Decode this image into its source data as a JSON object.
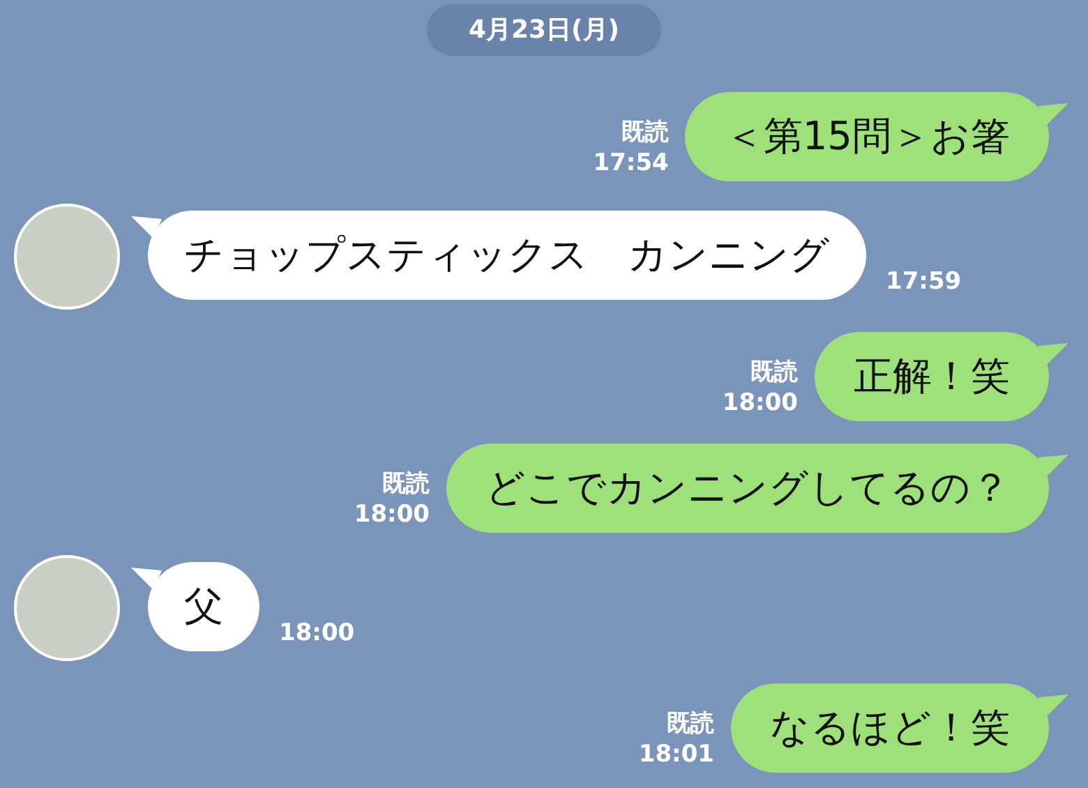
{
  "date_label": "4月23日(月)",
  "messages": [
    {
      "kind": "outgoing",
      "text": "＜第15問＞お箸",
      "read_label": "既読",
      "time": "17:54"
    },
    {
      "kind": "incoming",
      "text": "チョップスティックス　カンニング",
      "time": "17:59"
    },
    {
      "kind": "outgoing",
      "text": "正解！笑",
      "read_label": "既読",
      "time": "18:00"
    },
    {
      "kind": "outgoing",
      "text": "どこでカンニングしてるの？",
      "read_label": "既読",
      "time": "18:00"
    },
    {
      "kind": "incoming",
      "text": "父",
      "time": "18:00"
    },
    {
      "kind": "outgoing",
      "text": "なるほど！笑",
      "read_label": "既読",
      "time": "18:01"
    }
  ]
}
